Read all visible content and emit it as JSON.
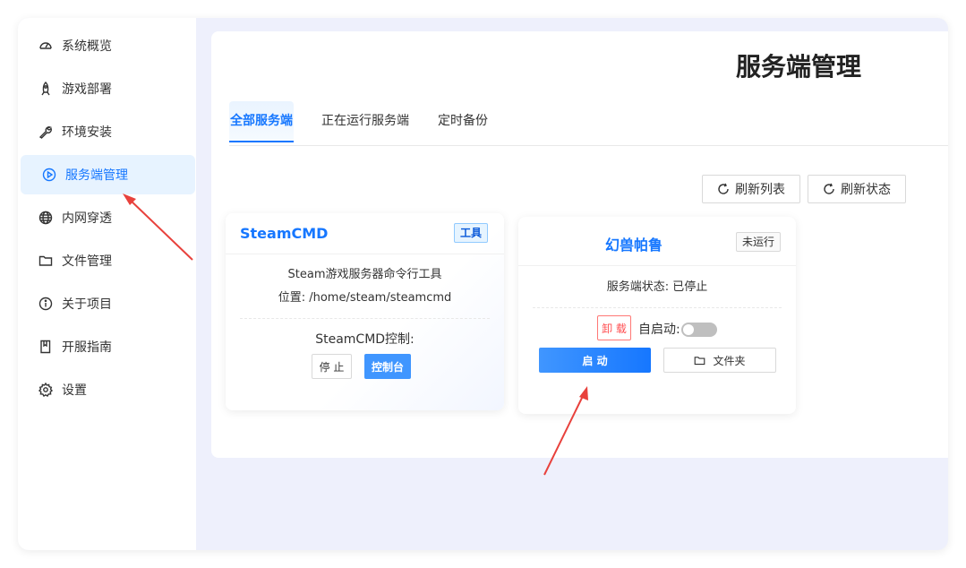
{
  "sidebar": {
    "items": [
      {
        "label": "系统概览",
        "icon": "dashboard-icon"
      },
      {
        "label": "游戏部署",
        "icon": "rocket-icon"
      },
      {
        "label": "环境安装",
        "icon": "wrench-icon"
      },
      {
        "label": "服务端管理",
        "icon": "play-circle-icon",
        "active": true
      },
      {
        "label": "内网穿透",
        "icon": "globe-icon"
      },
      {
        "label": "文件管理",
        "icon": "folder-icon"
      },
      {
        "label": "关于项目",
        "icon": "info-icon"
      },
      {
        "label": "开服指南",
        "icon": "book-icon"
      },
      {
        "label": "设置",
        "icon": "gear-icon"
      }
    ]
  },
  "page": {
    "title": "服务端管理"
  },
  "tabs": [
    {
      "label": "全部服务端",
      "active": true
    },
    {
      "label": "正在运行服务端"
    },
    {
      "label": "定时备份"
    }
  ],
  "toolbar": {
    "refresh_list": "刷新列表",
    "refresh_status": "刷新状态"
  },
  "steamcmd_card": {
    "title": "SteamCMD",
    "tag": "工具",
    "description": "Steam游戏服务器命令行工具",
    "location": "位置: /home/steam/steamcmd",
    "control_label": "SteamCMD控制:",
    "stop_label": "停 止",
    "console_label": "控制台"
  },
  "palworld_card": {
    "title": "幻兽帕鲁",
    "tag": "未运行",
    "status": "服务端状态: 已停止",
    "uninstall_label": "卸 载",
    "autostart_label": "自启动:",
    "autostart_on": false,
    "start_label": "启 动",
    "folder_label": "文件夹"
  },
  "colors": {
    "primary": "#1677ff",
    "annotation_arrow": "#e8413c",
    "danger": "#ff4d4f"
  }
}
